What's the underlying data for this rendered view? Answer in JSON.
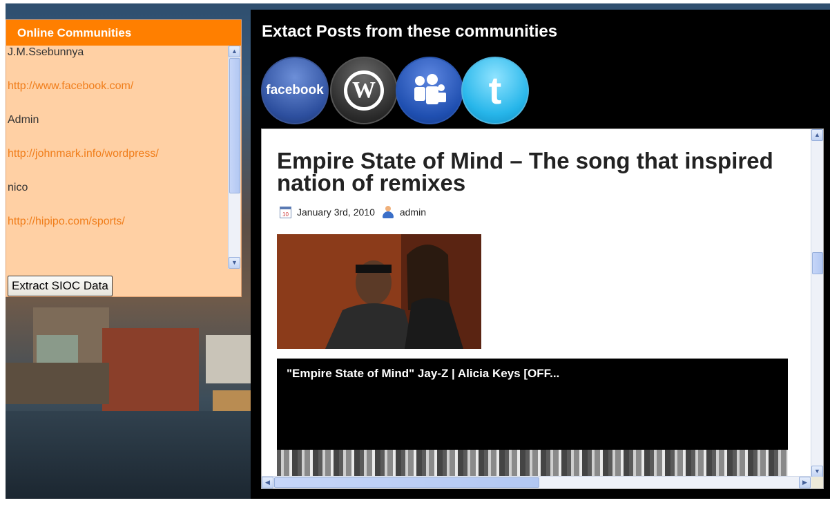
{
  "left_panel": {
    "title": "Online Communities",
    "items": [
      {
        "user": "J.M.Ssebunnya",
        "url": "http://www.facebook.com/"
      },
      {
        "user": "Admin",
        "url": "http://johnmark.info/wordpress/"
      },
      {
        "user": "nico",
        "url": "http://hipipo.com/sports/"
      }
    ],
    "extract_button": "Extract SIOC Data"
  },
  "right_panel": {
    "title": "Extact Posts from these communities",
    "social_icons": [
      {
        "name": "facebook-icon",
        "label": "facebook"
      },
      {
        "name": "wordpress-icon",
        "label": "W"
      },
      {
        "name": "myspace-icon"
      },
      {
        "name": "twitter-icon",
        "label": "t"
      }
    ],
    "post": {
      "title": "Empire State of Mind – The song that inspired nation of remixes",
      "date": "January 3rd, 2010",
      "author": "admin",
      "calendar_glyph": "10",
      "video_title": "\"Empire State of Mind\" Jay-Z | Alicia Keys [OFF..."
    }
  },
  "colors": {
    "panel_header": "#ff7f00",
    "panel_bg": "#ffd0a4",
    "url_text": "#f07d1a",
    "right_bg": "#000000"
  }
}
